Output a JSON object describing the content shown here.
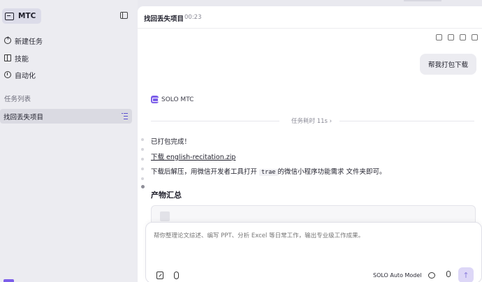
{
  "sidebar": {
    "brand_name": "MTC",
    "nav": [
      {
        "label": "新建任务",
        "icon": "new-chat-icon"
      },
      {
        "label": "技能",
        "icon": "book-icon"
      },
      {
        "label": "自动化",
        "icon": "clock-icon"
      }
    ],
    "section_title": "任务列表",
    "tasks": [
      {
        "label": "找回丢失项目",
        "icon": "task-list-icon"
      }
    ]
  },
  "header": {
    "title": "找回丢失项目",
    "time": "00:23"
  },
  "conversation": {
    "user_message": "帮我打包下载",
    "agent_name": "SOLO MTC",
    "elapsed": "任务耗时 11s ›",
    "done_text": "已打包完成！",
    "download_prefix": "下载 ",
    "download_file": "english-recitation.zip",
    "instruction_before": "下载后解压，用微信开发者工具打开 ",
    "instruction_code": "trae",
    "instruction_after": "的微信小程序功能需求 文件夹即可。",
    "artifacts_heading": "产物汇总"
  },
  "composer": {
    "placeholder": "帮你整理论文综述、编写 PPT、分析 Excel 等日常工作，输出专业级工作成果。",
    "model": "SOLO Auto Model",
    "send_icon": "arrow-up-icon"
  },
  "colors": {
    "accent": "#7c5ee9",
    "sidebar_bg": "#ececf1",
    "selected_bg": "#dadae2"
  }
}
